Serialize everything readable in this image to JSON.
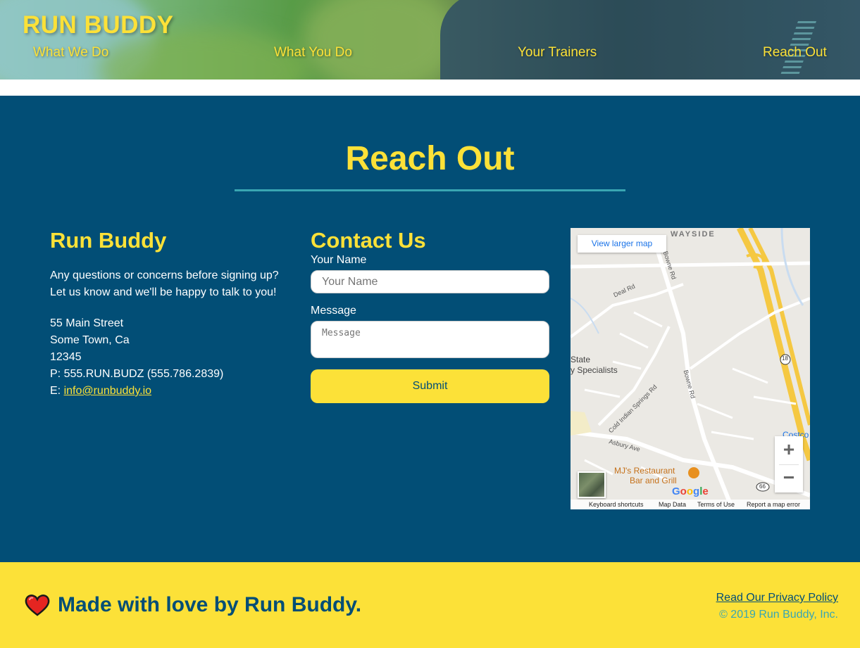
{
  "header": {
    "logo": "RUN BUDDY",
    "nav": [
      "What We Do",
      "What You Do",
      "Your Trainers",
      "Reach Out"
    ]
  },
  "section": {
    "title": "Reach Out"
  },
  "company": {
    "heading": "Run Buddy",
    "description_line1": "Any questions or concerns before signing up?",
    "description_line2": "Let us know and we'll be happy to talk to you!",
    "street": "55 Main Street",
    "city": "Some Town, Ca",
    "zip": "12345",
    "phone": "P: 555.RUN.BUDZ (555.786.2839)",
    "email_prefix": "E: ",
    "email": "info@runbuddy.io"
  },
  "contact": {
    "heading": "Contact Us",
    "name_label": "Your Name",
    "name_placeholder": "Your Name",
    "message_label": "Message",
    "message_placeholder": "Message",
    "submit_label": "Submit"
  },
  "map": {
    "larger_map": "View larger map",
    "labels": {
      "wayside": "WAYSIDE",
      "bowne_rd_1": "Bowne Rd",
      "deal_rd": "Deal Rd",
      "state": "State",
      "specialists": "y Specialists",
      "bowne_rd_2": "Bowne Rd",
      "cold_indian": "Cold Indian Springs Rd",
      "asbury": "Asbury Ave",
      "costco": "Costco Wh",
      "restaurant_1": "MJ's Restaurant",
      "restaurant_2": "Bar and Grill",
      "route_18": "18",
      "route_66": "66"
    },
    "footer": [
      "Keyboard shortcuts",
      "Map Data",
      "Terms of Use",
      "Report a map error"
    ],
    "brand": "Google",
    "zoom_in": "+",
    "zoom_out": "−"
  },
  "footer": {
    "made_with": "Made with love by Run Buddy.",
    "privacy": "Read Our Privacy Policy",
    "copyright": "© 2019 Run Buddy, Inc."
  },
  "colors": {
    "brand_yellow": "#fce138",
    "brand_navy": "#024e76",
    "accent_teal": "#39a6b2"
  }
}
